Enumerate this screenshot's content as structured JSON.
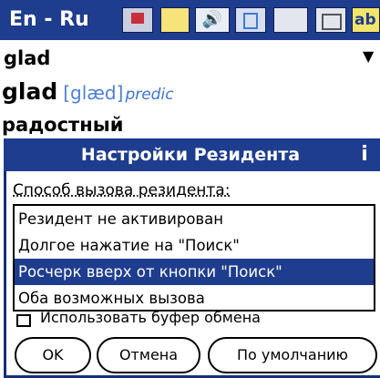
{
  "toolbar": {
    "direction_label": "En - Ru",
    "icons": [
      "flag-icon",
      "note-icon",
      "speaker-icon",
      "copy-icon",
      "book-icon",
      "grid-icon"
    ],
    "abc_label": "ab"
  },
  "search": {
    "value": "glad"
  },
  "entry": {
    "headword": "glad",
    "transcription": "[glæd]",
    "part_of_speech": "predic"
  },
  "translation": "радостный",
  "dialog": {
    "title": "Настройки Резидента",
    "info_label": "i",
    "method_label": "Способ вызова резидента:",
    "options": [
      {
        "label": "Резидент не активирован",
        "selected": false
      },
      {
        "label": "Долгое нажатие на \"Поиск\"",
        "selected": false
      },
      {
        "label": "Росчерк вверх от кнопки \"Поиск\"",
        "selected": true
      },
      {
        "label": "Оба возможных вызова",
        "selected": false
      }
    ],
    "checkbox_label": "Использовать буфер обмена",
    "buttons": {
      "ok": "OK",
      "cancel": "Отмена",
      "default": "По умолчанию"
    }
  },
  "colors": {
    "accent": "#1f3d8e",
    "transcription": "#4f7fd8",
    "selection": "#1f3d8e"
  }
}
